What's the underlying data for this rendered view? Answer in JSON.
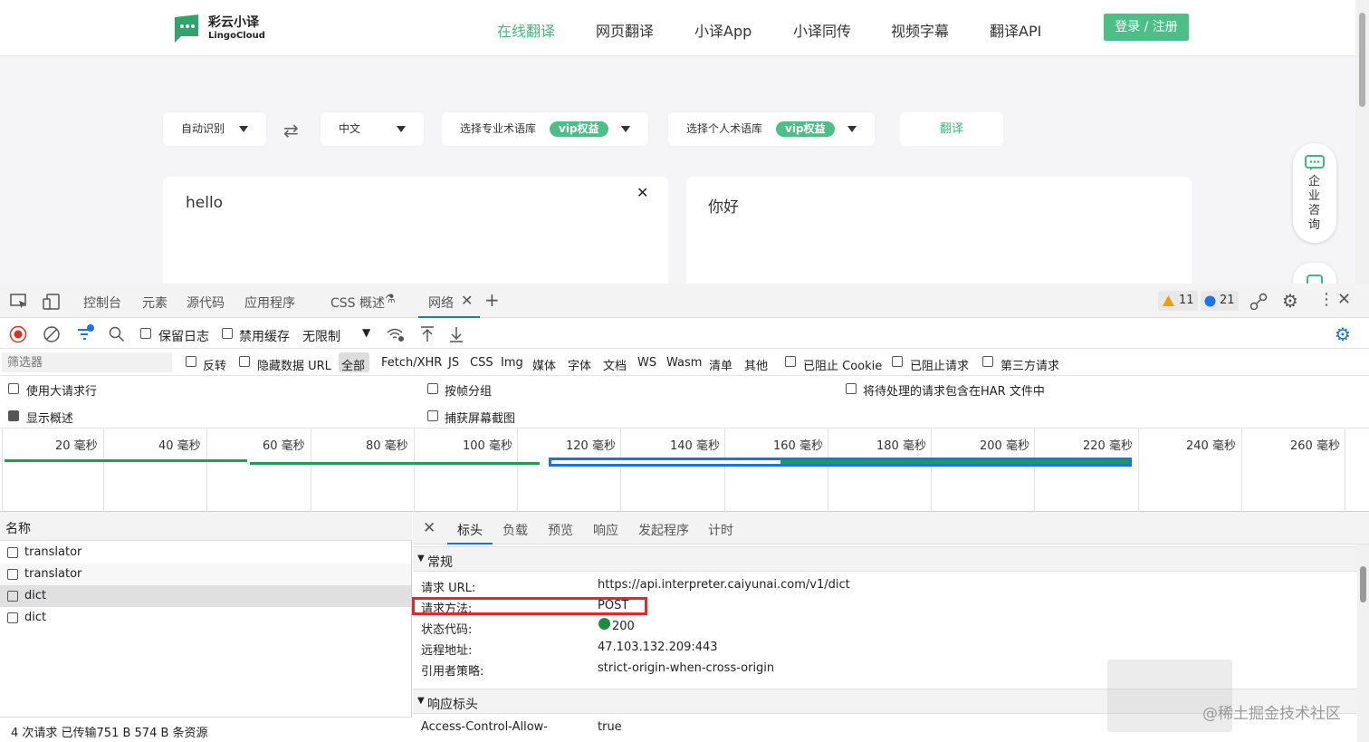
{
  "site": {
    "brand_cn": "彩云小译",
    "brand_en": "LingoCloud",
    "nav": [
      "在线翻译",
      "网页翻译",
      "小译App",
      "小译同传",
      "视频字幕",
      "翻译API"
    ],
    "login": "登录 / 注册",
    "source_lang": "自动识别",
    "target_lang": "中文",
    "pro_glossary": "选择专业术语库",
    "personal_glossary": "选择个人术语库",
    "vip_badge": "vip权益",
    "translate_button": "翻译",
    "source_text": "hello",
    "target_text": "你好",
    "consult": "企业咨询",
    "accent_color": "#4cbf87"
  },
  "devtools": {
    "tabs": [
      "控制台",
      "元素",
      "源代码",
      "应用程序",
      "CSS 概述",
      "网络"
    ],
    "warnings": "11",
    "messages": "21",
    "toolbar": {
      "preserve_log": "保留日志",
      "disable_cache": "禁用缓存",
      "throttle": "无限制"
    },
    "filter": {
      "placeholder": "筛选器",
      "invert": "反转",
      "hide_data_urls": "隐藏数据 URL",
      "types": [
        "全部",
        "Fetch/XHR",
        "JS",
        "CSS",
        "Img",
        "媒体",
        "字体",
        "文档",
        "WS",
        "Wasm",
        "清单",
        "其他"
      ],
      "blocked_cookies": "已阻止 Cookie",
      "blocked_requests": "已阻止请求",
      "third_party": "第三方请求"
    },
    "options": {
      "big_rows": "使用大请求行",
      "group_by_frame": "按帧分组",
      "include_har": "将待处理的请求包含在HAR 文件中",
      "show_overview": "显示概述",
      "capture_screenshots": "捕获屏幕截图"
    },
    "timeline_ticks": [
      "20  毫秒",
      "40  毫秒",
      "60  毫秒",
      "80  毫秒",
      "100  毫秒",
      "120  毫秒",
      "140  毫秒",
      "160  毫秒",
      "180  毫秒",
      "200  毫秒",
      "220  毫秒",
      "240  毫秒",
      "260  毫秒"
    ],
    "requests": {
      "header": "名称",
      "items": [
        "translator",
        "translator",
        "dict",
        "dict"
      ],
      "status": "4 次请求  已传输751 B  574 B 条资源"
    },
    "detail": {
      "tabs": [
        "标头",
        "负载",
        "预览",
        "响应",
        "发起程序",
        "计时"
      ],
      "general_title": "常规",
      "general": [
        {
          "k": "请求 URL:",
          "v": "https://api.interpreter.caiyunai.com/v1/dict"
        },
        {
          "k": "请求方法:",
          "v": "POST"
        },
        {
          "k": "状态代码:",
          "v": "200"
        },
        {
          "k": "远程地址:",
          "v": "47.103.132.209:443"
        },
        {
          "k": "引用者策略:",
          "v": "strict-origin-when-cross-origin"
        }
      ],
      "response_title": "响应标头",
      "response": [
        {
          "k": "Access-Control-Allow-",
          "v": "true"
        }
      ]
    }
  },
  "watermark": "@稀土掘金技术社区"
}
